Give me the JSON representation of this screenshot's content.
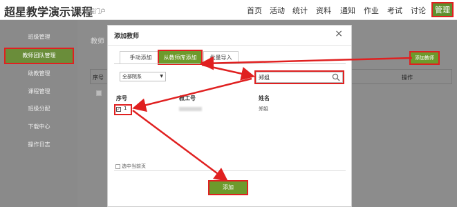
{
  "header": {
    "brand": "超星教学演示课程",
    "brand_sub": "课程门户",
    "nav": [
      {
        "label": "首页"
      },
      {
        "label": "活动"
      },
      {
        "label": "统计"
      },
      {
        "label": "资料"
      },
      {
        "label": "通知"
      },
      {
        "label": "作业"
      },
      {
        "label": "考试"
      },
      {
        "label": "讨论"
      },
      {
        "label": "管理"
      }
    ]
  },
  "sidebar": {
    "items": [
      {
        "label": "班级管理"
      },
      {
        "label": "教师团队管理"
      },
      {
        "label": "助教管理"
      },
      {
        "label": "课程管理"
      },
      {
        "label": "班级分配"
      },
      {
        "label": "下载中心"
      },
      {
        "label": "操作日志"
      }
    ]
  },
  "background": {
    "title_fragment": "教师",
    "col_index": "序号",
    "col_action": "操作",
    "add_teacher_button": "添加教师"
  },
  "modal": {
    "title": "添加教师",
    "close": "×",
    "tabs": [
      {
        "label": "手动添加"
      },
      {
        "label": "从教师库添加"
      },
      {
        "label": "批量导入"
      }
    ],
    "department_select": "全部院系",
    "search_value": "郑姐",
    "columns": {
      "index": "序号",
      "employee_id": "教工号",
      "name": "姓名"
    },
    "rows": [
      {
        "index": "1",
        "name": "郑姐",
        "checked": "✓"
      }
    ],
    "select_current_page": "选中当前页",
    "add_button": "添加"
  },
  "colors": {
    "accent": "#6d9a2c",
    "highlight": "#e02020"
  }
}
